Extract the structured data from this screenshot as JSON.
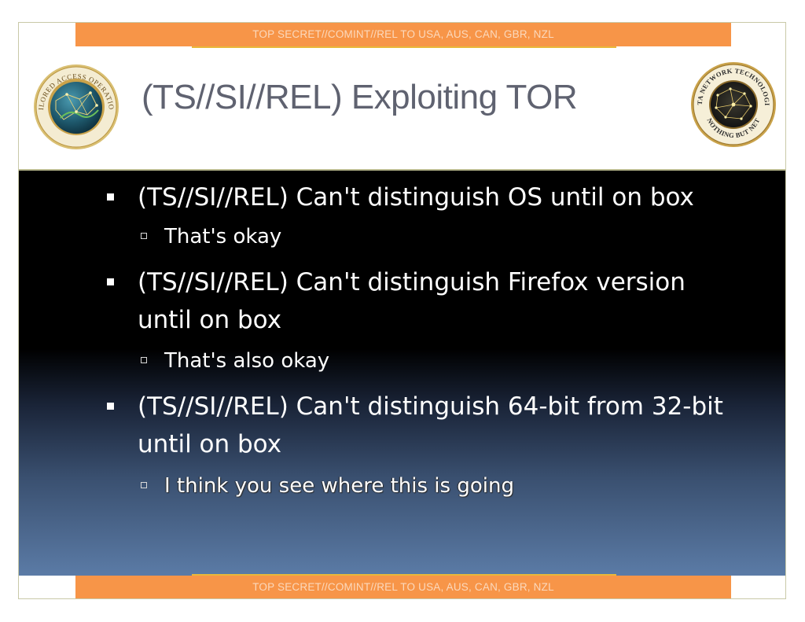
{
  "classification": {
    "top_banner": "TOP SECRET//COMINT//REL TO USA, AUS, CAN, GBR, NZL",
    "bottom_banner": "TOP SECRET//COMINT//REL TO USA, AUS, CAN, GBR, NZL"
  },
  "header": {
    "title": "(TS//SI//REL) Exploiting TOR",
    "left_seal_text": "TAILORED ACCESS OPERATIONS",
    "right_seal_text_top": "DATA NETWORK TECHNOLOGIES",
    "right_seal_text_bottom": "NOTHING BUT NET"
  },
  "bullets": [
    {
      "text": "(TS//SI//REL) Can't distinguish OS until on box",
      "sub": "That's okay"
    },
    {
      "text": "(TS//SI//REL) Can't distinguish Firefox version until on box",
      "sub": "That's also okay"
    },
    {
      "text": "(TS//SI//REL) Can't distinguish 64-bit from 32-bit until on box",
      "sub": "I think you see where this is going"
    }
  ],
  "colors": {
    "banner": "#f79548",
    "title": "#5f6270",
    "seal_gold": "#c9a24a"
  }
}
